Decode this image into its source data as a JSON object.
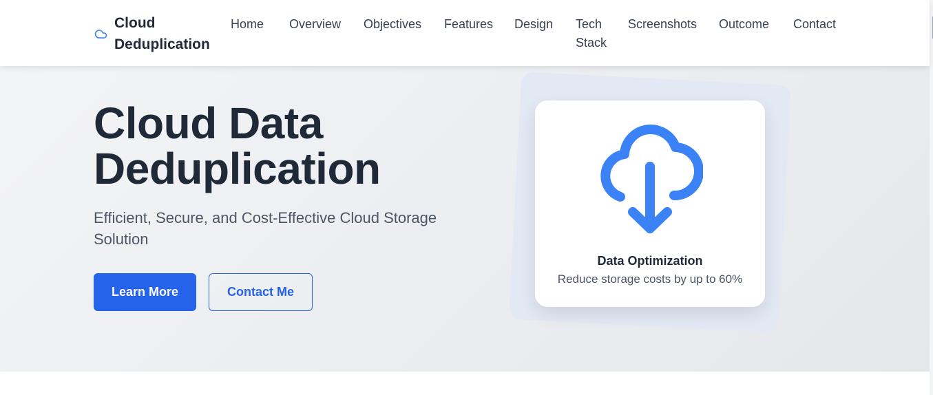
{
  "brand": {
    "name_line1": "Cloud",
    "name_line2": "Deduplication",
    "icon": "cloud-icon"
  },
  "nav": {
    "items": [
      {
        "label": "Home"
      },
      {
        "label": "Overview"
      },
      {
        "label": "Objectives"
      },
      {
        "label": "Features"
      },
      {
        "label": "Design"
      },
      {
        "label": "Tech",
        "label2": "Stack"
      },
      {
        "label": "Screenshots"
      },
      {
        "label": "Outcome"
      },
      {
        "label": "Contact"
      }
    ]
  },
  "hero": {
    "title_line1": "Cloud Data",
    "title_line2": "Deduplication",
    "subtitle": "Efficient, Secure, and Cost-Effective Cloud Storage Solution",
    "primary_button": "Learn More",
    "secondary_button": "Contact Me"
  },
  "card": {
    "icon": "cloud-download-icon",
    "title": "Data Optimization",
    "description": "Reduce storage costs by up to 60%"
  },
  "colors": {
    "accent": "#2563eb",
    "icon_blue": "#3b82f6",
    "text_dark": "#1f2937"
  }
}
